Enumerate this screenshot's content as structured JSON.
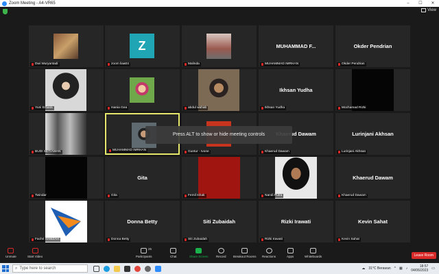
{
  "window": {
    "title": "Zoom Meeting - A4-VR65",
    "minimize": "–",
    "maximize": "☐",
    "close": "✕",
    "view_label": "View"
  },
  "tooltip": "Press ALT to show or hide meeting controls",
  "tiles": [
    {
      "label": "Dwi Wuryantadi",
      "big": "",
      "kind": "photo-wall"
    },
    {
      "label": "zoom liaa04",
      "big": "",
      "kind": "avatar-z",
      "avatar": "Z"
    },
    {
      "label": "Malinda",
      "big": "",
      "kind": "photo-stairs"
    },
    {
      "label": "MUHAMMAD IMRHAN",
      "big": "MUHAMMAD  F...",
      "kind": "name"
    },
    {
      "label": "Okder Pendrian",
      "big": "Okder Pendrian",
      "kind": "name"
    },
    {
      "label": "Yuni Erfianti",
      "big": "",
      "kind": "photo-hijab"
    },
    {
      "label": "Isania Gea",
      "big": "",
      "kind": "photo-cartoon"
    },
    {
      "label": "abdul wahab",
      "big": "",
      "kind": "photo-man"
    },
    {
      "label": "Ikhsan Yudha",
      "big": "Ikhsan Yudha",
      "kind": "name"
    },
    {
      "label": "Mochamad Rizki",
      "big": "",
      "kind": "black"
    },
    {
      "label": "BUDI SETIAWAN",
      "big": "",
      "kind": "photo-bw"
    },
    {
      "label": "MUHAMMAD IMRHAN",
      "big": "",
      "kind": "photo-small",
      "active": true
    },
    {
      "label": "Guntur - Ivone",
      "big": "",
      "kind": "photo-red"
    },
    {
      "label": "Khaerud Dawam",
      "big": "Khaerud Dawam",
      "kind": "name"
    },
    {
      "label": "Lurinjani Akhsan",
      "big": "Lurinjani Akhsan",
      "kind": "name"
    },
    {
      "label": "Twindar",
      "big": "",
      "kind": "black"
    },
    {
      "label": "Gita",
      "big": "Gita",
      "kind": "name"
    },
    {
      "label": "Femil Ishak",
      "big": "",
      "kind": "red-block"
    },
    {
      "label": "Nandi Putra",
      "big": "",
      "kind": "photo-portrait"
    },
    {
      "label": "Khaerud Dawam",
      "big": "Khaerud Dawam",
      "kind": "name"
    },
    {
      "label": "Fachri HAMZAH",
      "big": "",
      "kind": "logo"
    },
    {
      "label": "Donna Betty",
      "big": "Donna Betty",
      "kind": "name"
    },
    {
      "label": "Siti Zubaidah",
      "big": "Siti Zubaidah",
      "kind": "name"
    },
    {
      "label": "Rizki Irawati",
      "big": "Rizki Irawati",
      "kind": "name"
    },
    {
      "label": "Kevin Sahat",
      "big": "Kevin Sahat",
      "kind": "name"
    }
  ],
  "toolbar": {
    "unmute": "Unmute",
    "start_video": "Start Video",
    "participants": "Participants",
    "participants_count": "25",
    "chat": "Chat",
    "share_screen": "Share Screen",
    "record": "Record",
    "breakout_rooms": "Breakout Rooms",
    "reactions": "Reactions",
    "apps": "Apps",
    "whiteboards": "Whiteboards",
    "leave": "Leave Room"
  },
  "taskbar": {
    "search_placeholder": "Type here to search",
    "weather": "31°C  Berawan",
    "time": "18:57",
    "date": "04/06/2023"
  },
  "colors": {
    "tile_bg": "#262626",
    "active_border": "#e5e86a",
    "share_green": "#19b24b",
    "leave_red": "#d92a2a",
    "zoom_blue": "#2d8cff"
  }
}
